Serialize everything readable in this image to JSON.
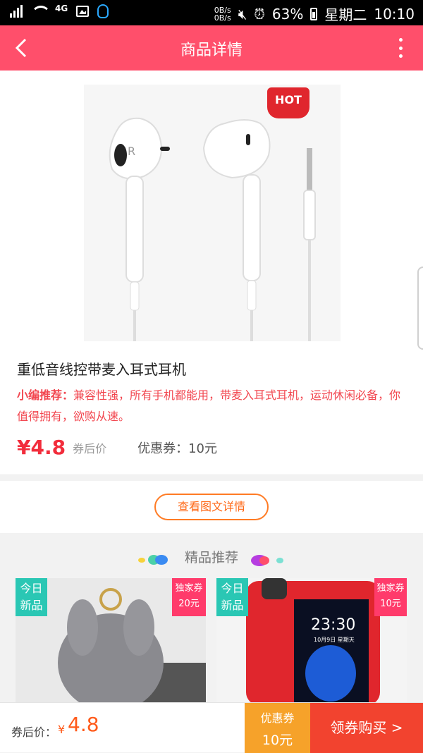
{
  "status_bar": {
    "network": "4G",
    "speed_up": "0B/s",
    "speed_down": "0B/s",
    "battery": "63%",
    "weekday": "星期二",
    "time": "10:10"
  },
  "header": {
    "title": "商品详情"
  },
  "product": {
    "hot_badge": "HOT",
    "title": "重低音线控带麦入耳式耳机",
    "recommend_label": "小编推荐：",
    "recommend_text": "兼容性强，所有手机都能用，带麦入耳式耳机，运动休闲必备，你值得拥有，欲购从速。",
    "price": "¥4.8",
    "after_coupon_label": "券后价",
    "coupon": "优惠券：10元"
  },
  "detail_button": "查看图文详情",
  "recommend_section": {
    "title": "精品推荐",
    "cards": [
      {
        "today_l1": "今日",
        "today_l2": "新品",
        "excl_l1": "独家券",
        "excl_l2": "20元"
      },
      {
        "today_l1": "今日",
        "today_l2": "新品",
        "excl_l1": "独家券",
        "excl_l2": "10元"
      }
    ],
    "phone_time": "23:30",
    "phone_date": "10月9日 星期天"
  },
  "bottom_bar": {
    "label": "券后价：",
    "yen": "¥",
    "price": "4.8",
    "coupon_l1": "优惠券",
    "coupon_l2": "10元",
    "buy": "领券购买 >"
  },
  "colors": {
    "header": "#ff4f6b",
    "price": "#f22d3c",
    "accent_orange": "#ff6a18",
    "teal_tag": "#2ac7b4",
    "pink_tag": "#ff3b6b",
    "coupon_bg": "#f6a22a",
    "buy_bg": "#f2432f"
  }
}
